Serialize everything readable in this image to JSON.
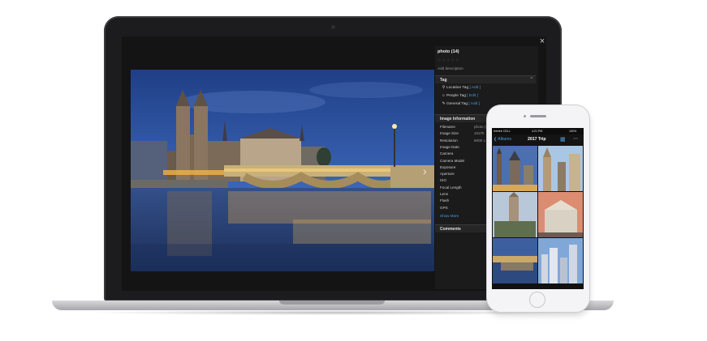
{
  "viewer": {
    "close_glyph": "×",
    "next_glyph": "›",
    "photo_title": "photo (14)",
    "rating_stars": "☆☆☆☆☆",
    "add_description": "Add description"
  },
  "tag_section": {
    "title": "Tag",
    "toggle_glyph": "^",
    "items": [
      {
        "icon": "location-pin-icon",
        "glyph": "⚲",
        "label": "Location Tag",
        "action": "[ Add ]"
      },
      {
        "icon": "person-icon",
        "glyph": "☺",
        "label": "People Tag",
        "action": "[ Edit ]"
      },
      {
        "icon": "tag-icon",
        "glyph": "✎",
        "label": "General Tag",
        "action": "[ Add ]"
      }
    ]
  },
  "info_section": {
    "title": "Image Information",
    "rows": [
      {
        "label": "Filename",
        "value": "photo (14"
      },
      {
        "label": "Image Size",
        "value": "1027k"
      },
      {
        "label": "Resolution",
        "value": "5000 x"
      },
      {
        "label": "Image Date",
        "value": ""
      },
      {
        "label": "Camera",
        "value": ""
      },
      {
        "label": "Camera Model",
        "value": ""
      },
      {
        "label": "Exposure",
        "value": ""
      },
      {
        "label": "Aperture",
        "value": ""
      },
      {
        "label": "ISO",
        "value": ""
      },
      {
        "label": "Focal Length",
        "value": ""
      },
      {
        "label": "Lens",
        "value": ""
      },
      {
        "label": "Flash",
        "value": ""
      },
      {
        "label": "GPS",
        "value": ""
      }
    ],
    "show_more": "Show More"
  },
  "comments_section": {
    "title": "Comments"
  },
  "phone": {
    "status_left": "●●●●● CELL",
    "status_time": "4:21 PM",
    "status_right": "100%",
    "back_label": "❮ Albums",
    "album_title": "2017 Trip",
    "grid_glyph": "▦",
    "more_glyph": "⋯"
  },
  "colors": {
    "accent": "#4a9de0",
    "panel_bg": "#1b1b1b",
    "laptop_bezel": "#1c1c1e"
  }
}
